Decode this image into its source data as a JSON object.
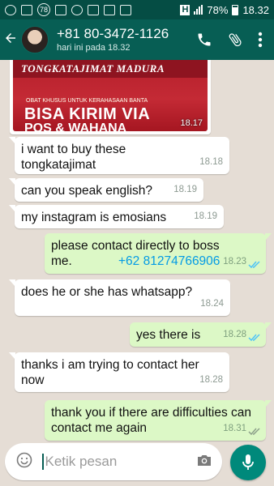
{
  "status_bar": {
    "notification_count": "78",
    "signal_label": "H",
    "battery": "78%",
    "time": "18.32"
  },
  "header": {
    "contact_name": "+81 80-3472-1126",
    "last_seen": "hari ini pada 18.32"
  },
  "photo_message": {
    "brand_text": "TONGKATAJIMAT MADURA",
    "small_text": "OBAT KHUSUS UNTUK KERAHASAAN BANTA",
    "headline_line1": "BISA KIRIM VIA",
    "headline_line2": "POS & WAHANA",
    "time": "18.17"
  },
  "messages": [
    {
      "direction": "in",
      "text": "i want to buy these tongkatajimat",
      "time": "18.18"
    },
    {
      "direction": "in",
      "text": "can you speak english?",
      "time": "18.19"
    },
    {
      "direction": "in",
      "text": "my instagram is emosians",
      "time": "18.19"
    },
    {
      "direction": "out",
      "text": "please contact directly to boss me.",
      "phone": "+62 81274766906",
      "time": "18.23",
      "status": "read"
    },
    {
      "direction": "in",
      "text": "does he or she has whatsapp?",
      "time": "18.24"
    },
    {
      "direction": "out",
      "text": "yes there is",
      "time": "18.28",
      "status": "read"
    },
    {
      "direction": "in",
      "text": "thanks i am trying to contact her now",
      "time": "18.28"
    },
    {
      "direction": "out",
      "text": "thank you if there are difficulties can contact me again",
      "time": "18.31",
      "status": "delivered"
    }
  ],
  "composer": {
    "placeholder": "Ketik pesan"
  },
  "colors": {
    "app_bar": "#075e54",
    "status_bar": "#054d44",
    "outgoing_bubble": "#dcf8c6",
    "incoming_bubble": "#ffffff",
    "chat_background": "#e5ddd5",
    "read_ticks": "#4fc3f7",
    "delivered_ticks": "#8da08a",
    "mic_button": "#00897b"
  },
  "icons": {
    "back": "arrow-left-icon",
    "call": "phone-icon",
    "attach": "paperclip-icon",
    "menu": "more-vert-icon",
    "emoji": "smiley-icon",
    "camera": "camera-icon",
    "mic": "mic-icon"
  }
}
